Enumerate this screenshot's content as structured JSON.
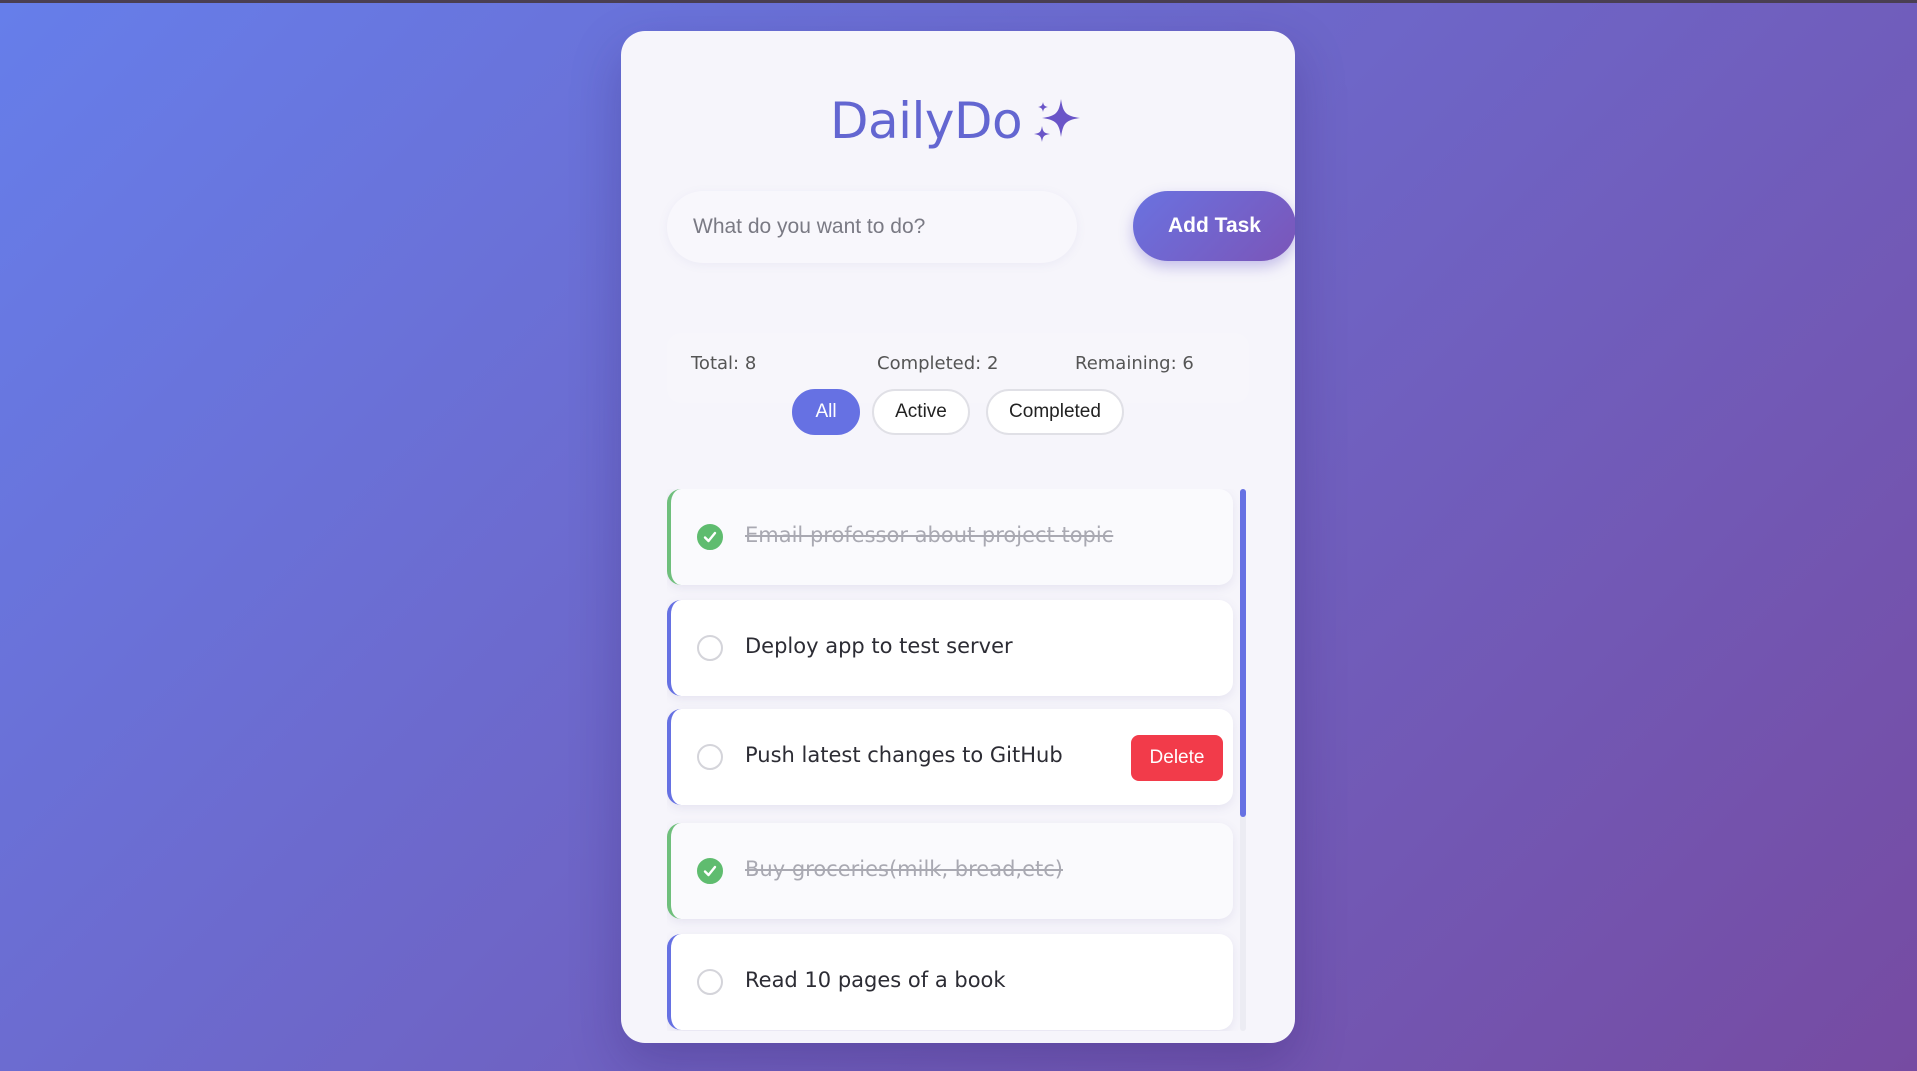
{
  "app": {
    "title": "DailyDo",
    "title_icon": "sparkles-icon"
  },
  "input": {
    "placeholder": "What do you want to do?",
    "value": ""
  },
  "add_button": {
    "label": "Add Task"
  },
  "stats": {
    "total": "Total: 8",
    "completed": "Completed: 2",
    "remaining": "Remaining: 6"
  },
  "filters": {
    "all": "All",
    "active": "Active",
    "completed": "Completed",
    "selected": "All"
  },
  "tasks": [
    {
      "text": "Email professor about project topic",
      "completed": true
    },
    {
      "text": "Deploy app to test server",
      "completed": false
    },
    {
      "text": "Push latest changes to GitHub",
      "completed": false,
      "delete_label": "Delete"
    },
    {
      "text": "Buy groceries(milk, bread,etc)",
      "completed": true
    },
    {
      "text": "Read 10 pages of a book",
      "completed": false
    }
  ],
  "colors": {
    "accent": "#6671e3",
    "title": "#6366d1",
    "completed_green": "#5fbc6f",
    "delete_red": "#f23b4a",
    "background_start": "#667eea",
    "background_end": "#764ba2"
  }
}
